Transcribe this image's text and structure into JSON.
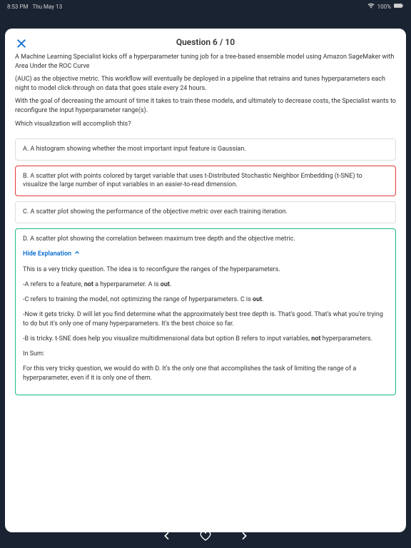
{
  "status": {
    "time": "8:53 PM",
    "date": "Thu May 13",
    "battery": "100%"
  },
  "title": "Question 6 / 10",
  "question": {
    "p1": "A Machine Learning Specialist kicks off a hyperparameter tuning job for a tree-based ensemble model using Amazon SageMaker with Area Under the ROC Curve",
    "p2": "(AUC) as the objective metric. This workflow will eventually be deployed in a pipeline that retrains and tunes hyperparameters each night to model click-through on data that goes stale every 24 hours.",
    "p3": "With the goal of decreasing the amount of time it takes to train these models, and ultimately to decrease costs, the Specialist wants to reconfigure the input hyperparameter range(s).",
    "p4": "Which visualization will accomplish this?"
  },
  "options": {
    "a": "A. A histogram showing whether the most important input feature is Gaussian.",
    "b": "B. A scatter plot with points colored by target variable that uses t-Distributed Stochastic Neighbor Embedding (t-SNE) to visualize the large number of input variables in an easier-to-read dimension.",
    "c": "C. A scatter plot showing the performance of the objective metric over each training iteration.",
    "d": "D. A scatter plot showing the correlation between maximum tree depth and the objective metric."
  },
  "toggle": "Hide Explanation",
  "explain": {
    "e1": "This is a very tricky question. The idea is to reconfigure the ranges of the hyperparameters.",
    "e2a": "-A refers to a feature, ",
    "e2b": "not",
    "e2c": " a hyperparameter. A is ",
    "e2d": "out",
    "e2e": ".",
    "e3a": "-C refers to training the model, not optimizing the range of hyperparameters. C is ",
    "e3b": "out",
    "e3c": ".",
    "e4": "-Now it gets tricky. D will let you find determine what the approximately best tree depth is. That's good. That's what you're trying to do but it's only one of many hyperparameters. It's the best choice so far.",
    "e5a": "-B is tricky. t-SNE does help you visualize multidimensional data but option B refers to input variables, ",
    "e5b": "not",
    "e5c": " hyperparameters.",
    "e6": "In Sum:",
    "e7": "For this very tricky question, we would do with D. It's the only one that accomplishes the task of limiting the range of a hyperparameter, even if it is only one of them."
  }
}
